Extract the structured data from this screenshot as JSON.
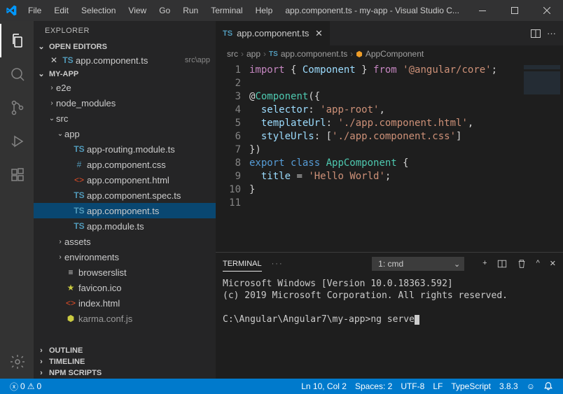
{
  "title": "app.component.ts - my-app - Visual Studio C...",
  "menu": [
    "File",
    "Edit",
    "Selection",
    "View",
    "Go",
    "Run",
    "Terminal",
    "Help"
  ],
  "sidebar": {
    "title": "EXPLORER",
    "sections": {
      "open_editors": "OPEN EDITORS",
      "workspace": "MY-APP",
      "outline": "OUTLINE",
      "timeline": "TIMELINE",
      "npm": "NPM SCRIPTS"
    },
    "open_editor_item": {
      "name": "app.component.ts",
      "path": "src\\app"
    },
    "tree": [
      {
        "label": "e2e",
        "type": "folder",
        "depth": 1,
        "open": false
      },
      {
        "label": "node_modules",
        "type": "folder",
        "depth": 1,
        "open": false
      },
      {
        "label": "src",
        "type": "folder",
        "depth": 1,
        "open": true
      },
      {
        "label": "app",
        "type": "folder",
        "depth": 2,
        "open": true
      },
      {
        "label": "app-routing.module.ts",
        "type": "ts",
        "depth": 3
      },
      {
        "label": "app.component.css",
        "type": "css",
        "depth": 3
      },
      {
        "label": "app.component.html",
        "type": "html",
        "depth": 3
      },
      {
        "label": "app.component.spec.ts",
        "type": "ts",
        "depth": 3
      },
      {
        "label": "app.component.ts",
        "type": "ts",
        "depth": 3,
        "selected": true
      },
      {
        "label": "app.module.ts",
        "type": "ts",
        "depth": 3
      },
      {
        "label": "assets",
        "type": "folder",
        "depth": 2,
        "open": false
      },
      {
        "label": "environments",
        "type": "folder",
        "depth": 2,
        "open": false
      },
      {
        "label": "browserslist",
        "type": "file",
        "depth": 2
      },
      {
        "label": "favicon.ico",
        "type": "star",
        "depth": 2
      },
      {
        "label": "index.html",
        "type": "html",
        "depth": 2
      },
      {
        "label": "karma.conf.js",
        "type": "js",
        "depth": 2,
        "dim": true
      }
    ]
  },
  "tab": {
    "name": "app.component.ts"
  },
  "breadcrumb": [
    "src",
    "app",
    "app.component.ts",
    "AppComponent"
  ],
  "code": {
    "lines": 11,
    "l1": {
      "a": "import",
      "b": "{ ",
      "c": "Component",
      "d": " }",
      "e": " from ",
      "f": "'@angular/core'",
      "g": ";"
    },
    "l3": {
      "a": "@",
      "b": "Component",
      "c": "({"
    },
    "l4": {
      "a": "selector",
      "b": ": ",
      "c": "'app-root'",
      "d": ","
    },
    "l5": {
      "a": "templateUrl",
      "b": ": ",
      "c": "'./app.component.html'",
      "d": ","
    },
    "l6": {
      "a": "styleUrls",
      "b": ": [",
      "c": "'./app.component.css'",
      "d": "]"
    },
    "l7": "})",
    "l8": {
      "a": "export ",
      "b": "class ",
      "c": "AppComponent ",
      "d": "{"
    },
    "l9": {
      "a": "title",
      "b": " = ",
      "c": "'Hello World'",
      "d": ";"
    },
    "l10": "}"
  },
  "terminal": {
    "tab_label": "TERMINAL",
    "shell": "1: cmd",
    "line1": "Microsoft Windows [Version 10.0.18363.592]",
    "line2": "(c) 2019 Microsoft Corporation. All rights reserved.",
    "prompt": "C:\\Angular\\Angular7\\my-app>",
    "cmd": "ng serve"
  },
  "status": {
    "errors": "0",
    "warnings": "0",
    "lncol": "Ln 10, Col 2",
    "spaces": "Spaces: 2",
    "encoding": "UTF-8",
    "eol": "LF",
    "lang": "TypeScript",
    "tsver": "3.8.3"
  }
}
